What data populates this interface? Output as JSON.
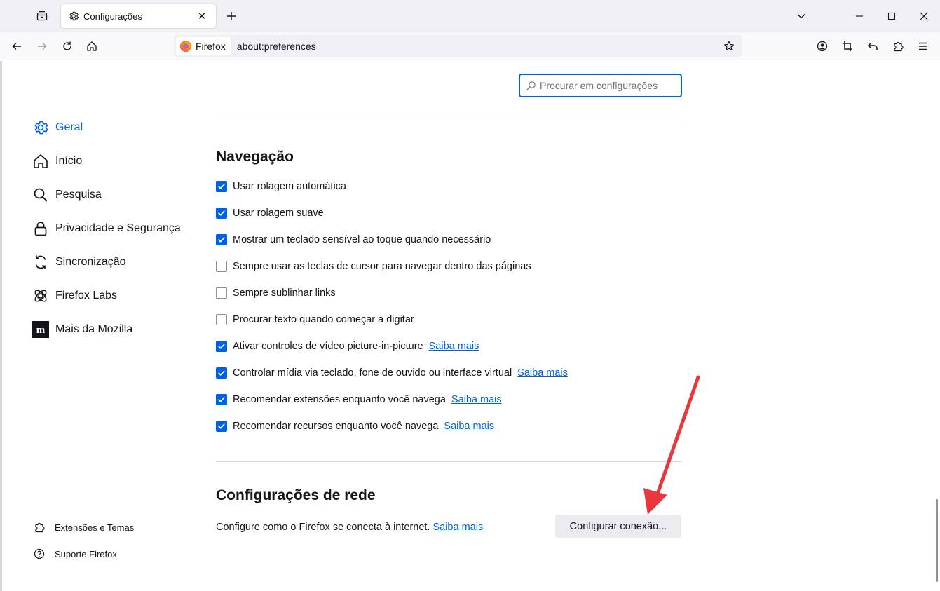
{
  "window": {
    "tab_title": "Configurações",
    "tab_close": "✕",
    "new_tab": "+",
    "tab_list_icon": "tab-list-icon",
    "controls": [
      "chevron-down-icon",
      "minimize-icon",
      "maximize-icon",
      "close-window-icon"
    ]
  },
  "navbar": {
    "identity_label": "Firefox",
    "url": "about:preferences",
    "buttons": [
      "back-icon",
      "forward-icon",
      "reload-icon",
      "home-icon"
    ],
    "toolbar_icons": [
      "account-icon",
      "screenshot-icon",
      "undo-icon",
      "extensions-icon",
      "menu-icon"
    ]
  },
  "search": {
    "placeholder": "Procurar em configurações"
  },
  "sidebar": {
    "categories": [
      {
        "label": "Geral",
        "icon": "gear-icon",
        "selected": true
      },
      {
        "label": "Início",
        "icon": "home-icon",
        "selected": false
      },
      {
        "label": "Pesquisa",
        "icon": "search-icon",
        "selected": false
      },
      {
        "label": "Privacidade e Segurança",
        "icon": "lock-icon",
        "selected": false
      },
      {
        "label": "Sincronização",
        "icon": "sync-icon",
        "selected": false
      },
      {
        "label": "Firefox Labs",
        "icon": "labs-icon",
        "selected": false
      },
      {
        "label": "Mais da Mozilla",
        "icon": "mozilla-icon",
        "selected": false
      }
    ],
    "footer": [
      {
        "label": "Extensões e Temas",
        "icon": "puzzle-icon"
      },
      {
        "label": "Suporte Firefox",
        "icon": "help-icon"
      }
    ]
  },
  "navigation": {
    "title": "Navegação",
    "options": [
      {
        "label": "Usar rolagem automática",
        "checked": true,
        "learn_more": ""
      },
      {
        "label": "Usar rolagem suave",
        "checked": true,
        "learn_more": ""
      },
      {
        "label": "Mostrar um teclado sensível ao toque quando necessário",
        "checked": true,
        "learn_more": ""
      },
      {
        "label": "Sempre usar as teclas de cursor para navegar dentro das páginas",
        "checked": false,
        "learn_more": ""
      },
      {
        "label": "Sempre sublinhar links",
        "checked": false,
        "learn_more": ""
      },
      {
        "label": "Procurar texto quando começar a digitar",
        "checked": false,
        "learn_more": ""
      },
      {
        "label": "Ativar controles de vídeo picture-in-picture",
        "checked": true,
        "learn_more": "Saiba mais"
      },
      {
        "label": "Controlar mídia via teclado, fone de ouvido ou interface virtual",
        "checked": true,
        "learn_more": "Saiba mais"
      },
      {
        "label": "Recomendar extensões enquanto você navega",
        "checked": true,
        "learn_more": "Saiba mais"
      },
      {
        "label": "Recomendar recursos enquanto você navega",
        "checked": true,
        "learn_more": "Saiba mais"
      }
    ]
  },
  "network": {
    "title": "Configurações de rede",
    "description": "Configure como o Firefox se conecta à internet.",
    "learn_more": "Saiba mais",
    "button_label": "Configurar conexão..."
  },
  "colors": {
    "accent": "#0061e0",
    "annotation_arrow": "#e8383d"
  }
}
